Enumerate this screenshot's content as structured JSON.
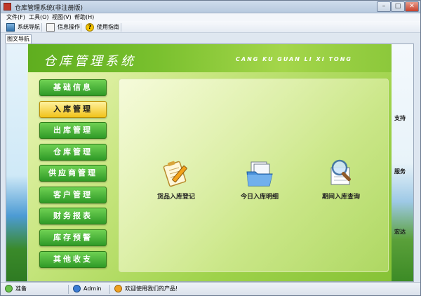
{
  "window": {
    "title": "仓库管理系统(非注册版)",
    "minimize": "–",
    "maximize": "□",
    "close": "✕"
  },
  "menubar": {
    "items": [
      "文件(F)",
      "工具(O)",
      "视图(V)",
      "帮助(H)"
    ]
  },
  "toolbar": {
    "nav_label": "系统导航",
    "info_label": "信息操作",
    "help_label": "使用指南"
  },
  "tabs": {
    "active": "图文导航"
  },
  "app": {
    "title": "仓库管理系统",
    "subtitle": "CANG KU GUAN LI XI TONG",
    "menu": [
      {
        "label": "基础信息",
        "active": false
      },
      {
        "label": "入库管理",
        "active": true
      },
      {
        "label": "出库管理",
        "active": false
      },
      {
        "label": "仓库管理",
        "active": false
      },
      {
        "label": "供应商管理",
        "active": false
      },
      {
        "label": "客户管理",
        "active": false
      },
      {
        "label": "财务报表",
        "active": false
      },
      {
        "label": "库存预警",
        "active": false
      },
      {
        "label": "其他收支",
        "active": false
      }
    ],
    "features": [
      {
        "label": "货品入库登记",
        "icon": "clipboard-pencil-icon"
      },
      {
        "label": "今日入库明细",
        "icon": "documents-folder-icon"
      },
      {
        "label": "期间入库查询",
        "icon": "magnifier-icon"
      }
    ]
  },
  "side_fragments": {
    "lines": [
      "支持",
      "服务",
      "宏达"
    ]
  },
  "statusbar": {
    "ready": "准备",
    "user": "Admin",
    "welcome": "欢迎使用我们的产品!"
  },
  "colors": {
    "menu_button": "#2f9a27",
    "menu_button_active": "#f1c21a",
    "header_band": "#79c02e"
  }
}
